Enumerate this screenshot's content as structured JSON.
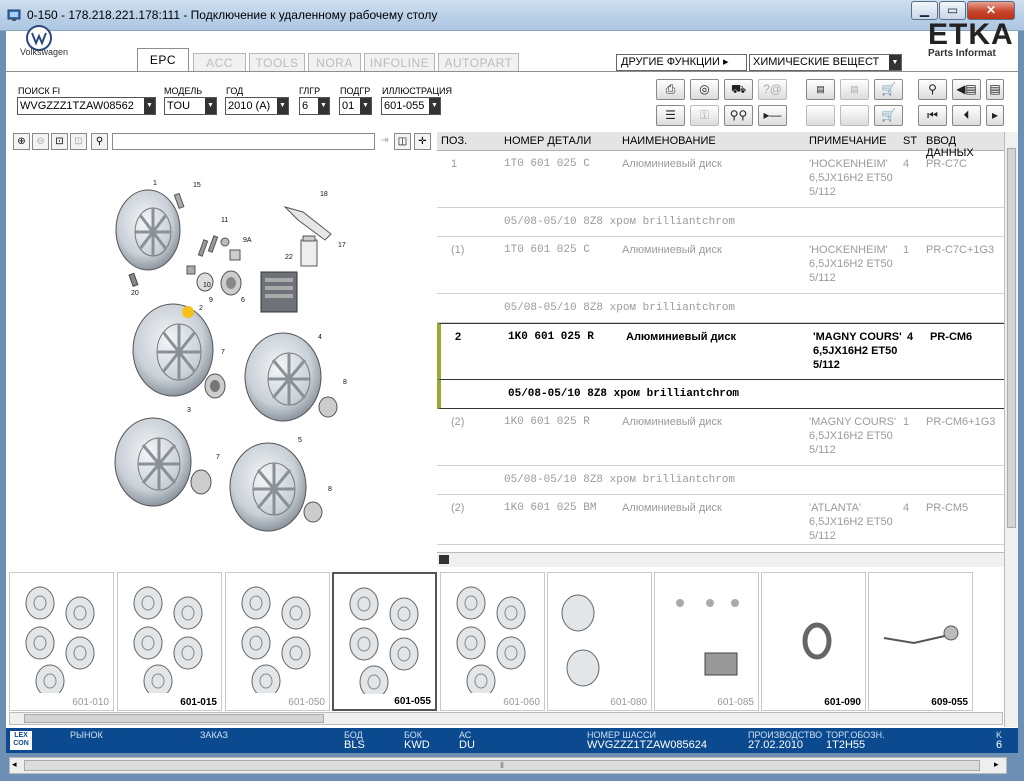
{
  "window": {
    "title": "0-150 - 178.218.221.178:111 - Подключение к удаленному рабочему столу"
  },
  "brand": {
    "vw_label": "Volkswagen",
    "etka": "ETKA",
    "etka_sub": "Parts Informat"
  },
  "tabs": [
    {
      "label": "EPC",
      "active": true
    },
    {
      "label": "ACC"
    },
    {
      "label": "TOOLS"
    },
    {
      "label": "NORA"
    },
    {
      "label": "INFOLINE"
    },
    {
      "label": "AUTOPART"
    }
  ],
  "other_functions": {
    "label": "ДРУГИЕ ФУНКЦИИ ▸",
    "value": "ХИМИЧЕСКИЕ ВЕЩЕСТ"
  },
  "filters": {
    "fi": {
      "label": "ПОИСК FI",
      "value": "WVGZZZ1TZAW08562"
    },
    "model": {
      "label": "МОДЕЛЬ",
      "value": "TOU"
    },
    "year": {
      "label": "ГОД",
      "value": "2010 (A)"
    },
    "group": {
      "label": "ГЛГР",
      "value": "6"
    },
    "subgroup": {
      "label": "ПОДГР",
      "value": "01"
    },
    "illustration": {
      "label": "ИЛЛЮСТРАЦИЯ",
      "value": "601-055"
    }
  },
  "table": {
    "headers": {
      "pos": "ПОЗ.",
      "part": "НОМЕР ДЕТАЛИ",
      "name": "НАИМЕНОВАНИЕ",
      "note": "ПРИМЕЧАНИЕ",
      "st": "ST",
      "input": "ВВОД ДАННЫХ"
    },
    "rows": [
      {
        "pos": "1",
        "part": "1T0 601 025 C",
        "name": "Алюминиевый диск",
        "note1": "'HOCKENHEIM'",
        "note2": "6,5JX16H2 ET50",
        "note3": "5/112",
        "st": "4",
        "input": "PR-C7C"
      },
      {
        "sub": "05/08-05/10 8Z8  хром brilliantchrom"
      },
      {
        "pos": "(1)",
        "part": "1T0 601 025 C",
        "name": "Алюминиевый диск",
        "note1": "'HOCKENHEIM'",
        "note2": "6,5JX16H2 ET50",
        "note3": "5/112",
        "st": "1",
        "input": "PR-C7C+1G3"
      },
      {
        "sub": "05/08-05/10 8Z8  хром brilliantchrom"
      },
      {
        "pos": "2",
        "part": "1K0 601 025 R",
        "name": "Алюминиевый диск",
        "note1": "'MAGNY COURS'",
        "note2": "6,5JX16H2 ET50",
        "note3": "5/112",
        "st": "4",
        "input": "PR-CM6"
      },
      {
        "sub": "05/08-05/10 8Z8  хром brilliantchrom"
      },
      {
        "pos": "(2)",
        "part": "1K0 601 025 R",
        "name": "Алюминиевый диск",
        "note1": "'MAGNY COURS'",
        "note2": "6,5JX16H2 ET50",
        "note3": "5/112",
        "st": "1",
        "input": "PR-CM6+1G3"
      },
      {
        "sub": "05/08-05/10 8Z8  хром brilliantchrom"
      },
      {
        "pos": "(2)",
        "part": "1K0 601 025 BM",
        "name": "Алюминиевый диск",
        "note1": "'ATLANTA'",
        "note2": "6,5JX16H2 ET50",
        "note3": "5/112",
        "st": "4",
        "input": "PR-CM5"
      }
    ]
  },
  "callouts": [
    "1",
    "15",
    "11",
    "9A",
    "10",
    "9",
    "6",
    "20",
    "18",
    "17",
    "22",
    "2",
    "7",
    "4",
    "8",
    "3",
    "7",
    "5",
    "8"
  ],
  "thumbnails": [
    {
      "label": "601-010"
    },
    {
      "label": "601-015"
    },
    {
      "label": "601-050"
    },
    {
      "label": "601-055"
    },
    {
      "label": "601-060"
    },
    {
      "label": "601-080"
    },
    {
      "label": "601-085"
    },
    {
      "label": "601-090"
    },
    {
      "label": "609-055"
    }
  ],
  "status": {
    "logo": "LEX CON",
    "market": {
      "label": "РЫНОК",
      "value": ""
    },
    "order": {
      "label": "ЗАКАЗ",
      "value": ""
    },
    "bod": {
      "label": "БОД",
      "value": "BLS"
    },
    "bok": {
      "label": "БОК",
      "value": "KWD"
    },
    "ac": {
      "label": "АС",
      "value": "DU"
    },
    "chassis": {
      "label": "НОМЕР ШАССИ",
      "value": "WVGZZZ1TZAW085624"
    },
    "production": {
      "label": "ПРОИЗВОДСТВО",
      "value": "27.02.2010"
    },
    "trade": {
      "label": "ТОРГ.ОБОЗН.",
      "value": "1T2H55"
    },
    "last": {
      "label": "K",
      "value": "6"
    }
  },
  "colors": {
    "status_bar": "#0b4a8e",
    "title_bar": "#c4d8ee",
    "selected_row_marker": "#9aa83a",
    "callout_highlight": "#f3c11a"
  },
  "icons": [
    "print-icon",
    "cd-icon",
    "car-icon",
    "question-icon",
    "elsa-icon",
    "depot-icon",
    "cart-icon",
    "pin-icon",
    "back-icon",
    "page-icon",
    "list-icon",
    "key-icon",
    "bike-icon",
    "play-icon",
    "first-icon",
    "prev-icon"
  ]
}
